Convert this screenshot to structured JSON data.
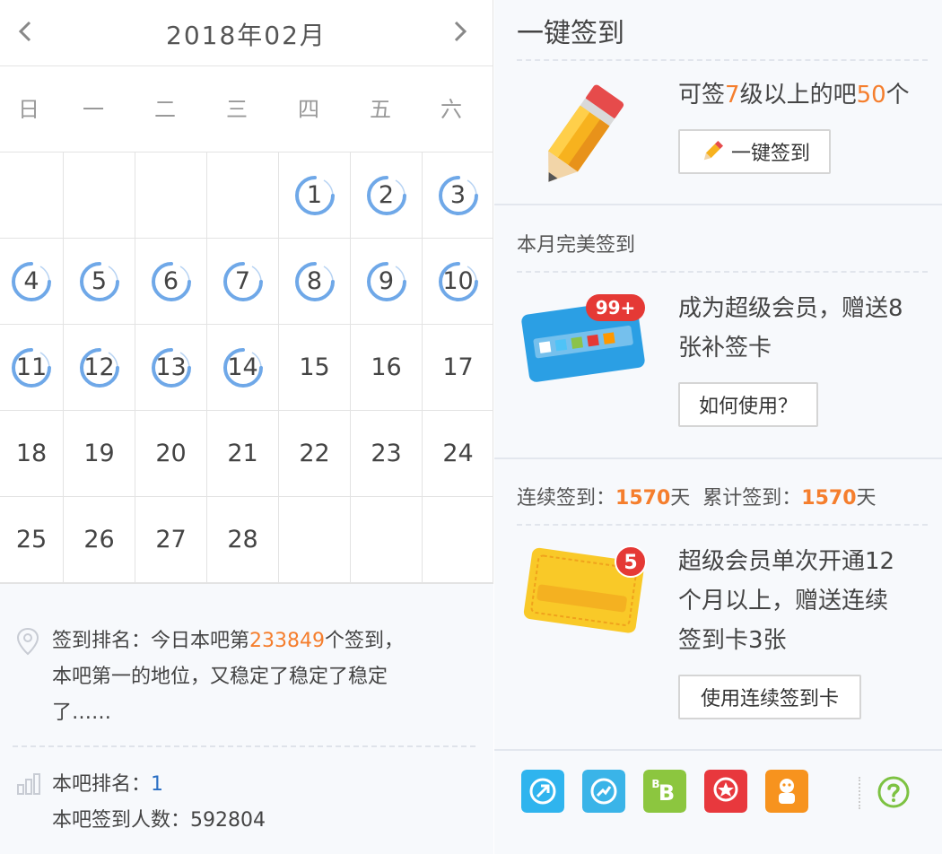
{
  "calendar": {
    "title": "2018年02月",
    "weekdays": [
      "日",
      "一",
      "二",
      "三",
      "四",
      "五",
      "六"
    ],
    "days": [
      "1",
      "2",
      "3",
      "4",
      "5",
      "6",
      "7",
      "8",
      "9",
      "10",
      "11",
      "12",
      "13",
      "14",
      "15",
      "16",
      "17",
      "18",
      "19",
      "20",
      "21",
      "22",
      "23",
      "24",
      "25",
      "26",
      "27",
      "28"
    ],
    "signed_days": [
      "1",
      "2",
      "3",
      "4",
      "5",
      "6",
      "7",
      "8",
      "9",
      "10",
      "11",
      "12",
      "13",
      "14"
    ]
  },
  "rank": {
    "label": "签到排名：今日本吧第",
    "number": "233849",
    "suffix_line1": "个签到，",
    "line2": "本吧第一的地位，又稳定了稳定了稳定",
    "line3": "了……"
  },
  "bar_rank": {
    "label": "本吧排名：",
    "value": "1",
    "count_label": "本吧签到人数：",
    "count_value": "592804"
  },
  "sign_all": {
    "title": "一键签到",
    "desc_prefix": "可签",
    "level": "7",
    "desc_mid": "级以上的吧",
    "count": "50",
    "desc_suffix": "个",
    "button": "一键签到"
  },
  "perfect": {
    "title": "本月完美签到",
    "badge": "99+",
    "desc_line1": "成为超级会员，赠送8",
    "desc_line2": "张补签卡",
    "button": "如何使用？"
  },
  "continuous": {
    "label1": "连续签到：",
    "value1": "1570",
    "unit1": "天",
    "label2": "累计签到：",
    "value2": "1570",
    "unit2": "天",
    "badge": "5",
    "desc_line1": "超级会员单次开通12",
    "desc_line2": "个月以上，赠送连续",
    "desc_line3": "签到卡3张",
    "button": "使用连续签到卡"
  },
  "colors": {
    "accent": "#f57e2d",
    "ring": "#6fa8e8",
    "link": "#2a6fc4"
  }
}
